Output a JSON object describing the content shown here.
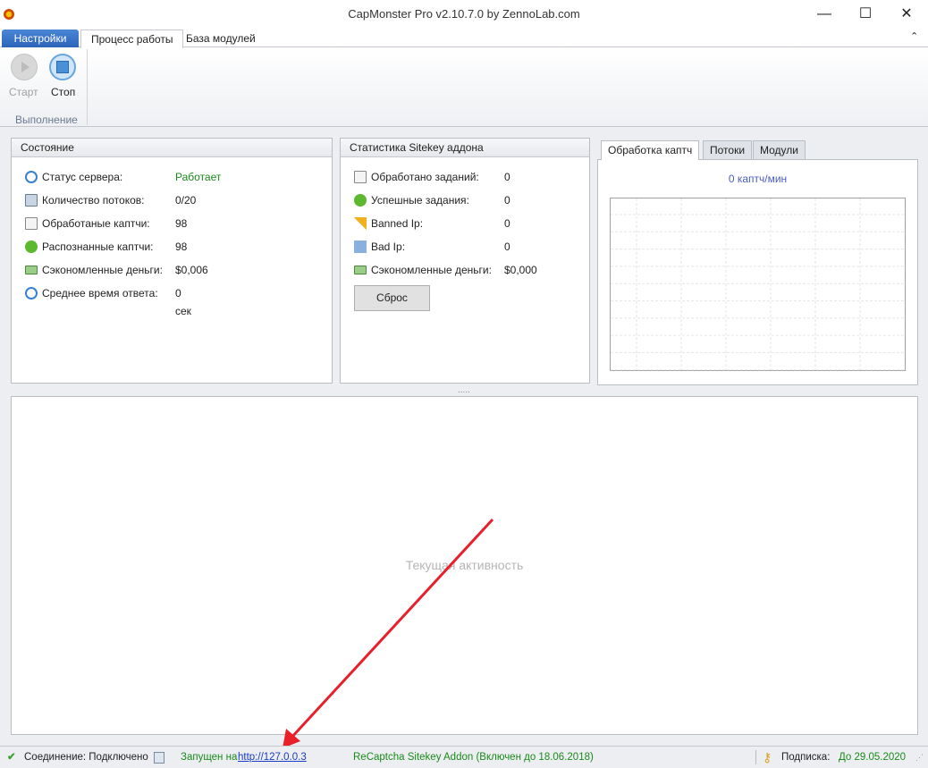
{
  "window": {
    "title": "CapMonster Pro v2.10.7.0 by ZennoLab.com",
    "minimize": "—",
    "maximize": "☐",
    "close": "✕"
  },
  "ribbon": {
    "tabs": [
      "Настройки",
      "Процесс работы",
      "База модулей"
    ],
    "start": "Старт",
    "stop": "Стоп",
    "group": "Выполнение",
    "collapse": "⌃"
  },
  "state": {
    "title": "Состояние",
    "rows": [
      {
        "label": "Статус сервера:",
        "value": "Работает",
        "icon": "play-circle-icon"
      },
      {
        "label": "Количество потоков:",
        "value": "0/20",
        "icon": "threads-icon"
      },
      {
        "label": "Обработаные каптчи:",
        "value": "98",
        "icon": "edit-icon"
      },
      {
        "label": "Распознанные каптчи:",
        "value": "98",
        "icon": "check-circle-icon"
      },
      {
        "label": "Сэкономленные деньги:",
        "value": "$0,006",
        "icon": "money-icon"
      },
      {
        "label": "Среднее время ответа:",
        "value": "0 сек",
        "icon": "clock-icon"
      }
    ]
  },
  "sitekey": {
    "title": "Статистика Sitekey аддона",
    "rows": [
      {
        "label": "Обработано заданий:",
        "value": "0",
        "icon": "edit-icon"
      },
      {
        "label": "Успешные задания:",
        "value": "0",
        "icon": "check-circle-icon"
      },
      {
        "label": "Banned Ip:",
        "value": "0",
        "icon": "warning-icon"
      },
      {
        "label": "Bad Ip:",
        "value": "0",
        "icon": "hourglass-icon"
      },
      {
        "label": "Сэкономленные деньги:",
        "value": "$0,000",
        "icon": "money-icon"
      }
    ],
    "reset": "Сброс"
  },
  "chart": {
    "tabs": [
      "Обработка каптч",
      "Потоки",
      "Модули"
    ],
    "rate": "0 каптч/мин"
  },
  "activity": {
    "placeholder": "Текущая активность",
    "splitter": "....."
  },
  "status": {
    "connection": "Соединение: Подключено",
    "running_prefix": "Запущен на",
    "url": "http://127.0.0.3",
    "addon": "ReCaptcha Sitekey Addon (Включен до 18.06.2018)",
    "sub_label": "Подписка:",
    "sub_value": "До 29.05.2020"
  },
  "colors": {
    "green": "#1a8a1a",
    "link": "#1a3cc8",
    "accent": "#2b62b8",
    "arrow": "#e8202a"
  }
}
